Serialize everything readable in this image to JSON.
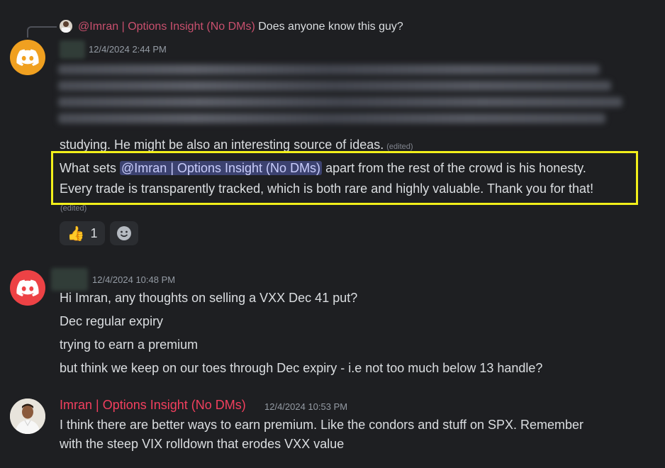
{
  "reply": {
    "mention": "@Imran | Options Insight (No DMs)",
    "text": "Does anyone know this guy?"
  },
  "messages": [
    {
      "timestamp": "12/4/2024 2:44 PM",
      "avatar_color": "#f0a020",
      "visible_line": "studying. He might be also an interesting source of ideas.",
      "edited": "(edited)",
      "highlight": {
        "prefix": "What sets ",
        "mention": "@Imran | Options Insight (No DMs)",
        "suffix": " apart from the rest of the crowd is his honesty.",
        "line2": "Every trade is transparently tracked, which is both rare and highly valuable. Thank you for that!"
      },
      "edited2": "(edited)",
      "reactions": [
        {
          "emoji": "👍",
          "count": "1"
        }
      ]
    },
    {
      "timestamp": "12/4/2024 10:48 PM",
      "avatar_color": "#ed4245",
      "lines": [
        "Hi Imran, any thoughts on selling a VXX Dec 41 put?",
        "Dec regular expiry",
        "trying to earn a premium",
        "but think we keep on our toes through Dec expiry - i.e not too much below 13 handle?"
      ]
    },
    {
      "author": "Imran | Options Insight (No DMs)",
      "timestamp": "12/4/2024 10:53 PM",
      "lines": [
        "I think there are better ways to earn premium.  Like the condors and stuff on SPX.  Remember",
        "with the steep VIX rolldown that erodes VXX value"
      ]
    }
  ],
  "colors": {
    "background": "#1e1f22",
    "highlight_border": "#f2ef1a",
    "author_color": "#f23f5e",
    "mention_bg": "#3c4270"
  }
}
